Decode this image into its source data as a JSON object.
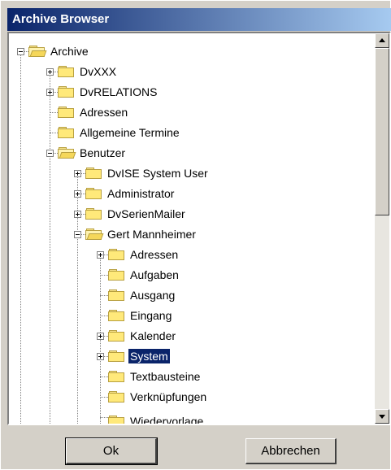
{
  "window": {
    "title": "Archive Browser"
  },
  "tree": {
    "nodes": [
      {
        "label": "Archive",
        "expander": "minus",
        "open": true
      },
      {
        "label": "DvXXX",
        "expander": "plus"
      },
      {
        "label": "DvRELATIONS",
        "expander": "plus"
      },
      {
        "label": "Adressen",
        "expander": "none"
      },
      {
        "label": "Allgemeine Termine",
        "expander": "none"
      },
      {
        "label": "Benutzer",
        "expander": "minus",
        "open": true
      },
      {
        "label": "DvISE System User",
        "expander": "plus"
      },
      {
        "label": "Administrator",
        "expander": "plus"
      },
      {
        "label": "DvSerienMailer",
        "expander": "plus"
      },
      {
        "label": "Gert Mannheimer",
        "expander": "minus",
        "open": true
      },
      {
        "label": "Adressen",
        "expander": "plus"
      },
      {
        "label": "Aufgaben",
        "expander": "none"
      },
      {
        "label": "Ausgang",
        "expander": "none"
      },
      {
        "label": "Eingang",
        "expander": "none"
      },
      {
        "label": "Kalender",
        "expander": "plus"
      },
      {
        "label": "System",
        "expander": "plus",
        "selected": true
      },
      {
        "label": "Textbausteine",
        "expander": "none"
      },
      {
        "label": "Verknüpfungen",
        "expander": "none"
      },
      {
        "label": "Wiedervorlage",
        "expander": "none"
      }
    ]
  },
  "buttons": {
    "ok": "Ok",
    "cancel": "Abbrechen"
  },
  "colors": {
    "selection": "#0a246a",
    "titlebar_start": "#0a246a",
    "titlebar_end": "#a6caf0",
    "folder": "#ffe97a"
  }
}
